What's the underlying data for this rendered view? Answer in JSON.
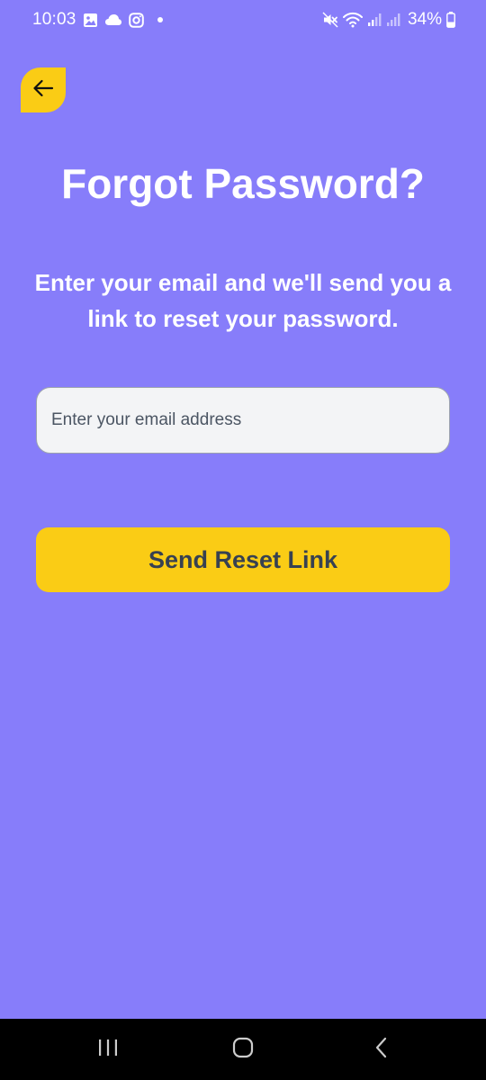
{
  "status_bar": {
    "time": "10:03",
    "battery": "34%",
    "left_icons": [
      "gallery-icon",
      "cloud-icon",
      "instagram-icon",
      "dot-icon"
    ],
    "right_icons": [
      "mute-icon",
      "wifi-icon",
      "signal-icon",
      "signal-icon",
      "battery-icon"
    ]
  },
  "header": {
    "back_icon": "arrow-left-icon"
  },
  "main": {
    "title": "Forgot Password?",
    "subtitle": "Enter your email and we'll send you a link to reset your password.",
    "email_input": {
      "value": "",
      "placeholder": "Enter your email address"
    },
    "submit_label": "Send Reset Link"
  },
  "nav_bar": {
    "icons": [
      "recents-icon",
      "home-icon",
      "back-icon"
    ]
  },
  "colors": {
    "background": "#877dfa",
    "accent": "#facc15",
    "input_background": "#f3f4f6",
    "button_text": "#374151",
    "title_text": "#ffffff"
  }
}
